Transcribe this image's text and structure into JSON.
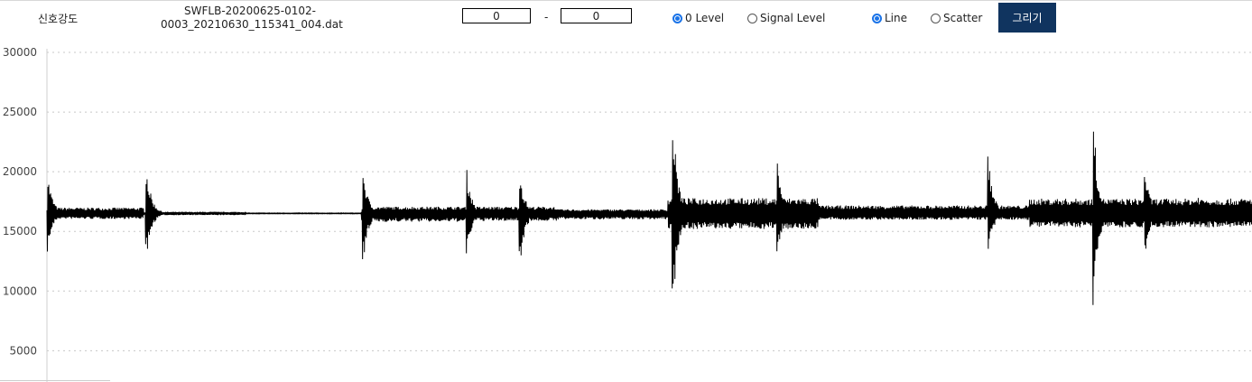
{
  "toolbar": {
    "signal_label": "신호강도",
    "file_name_line1": "SWFLB-20200625-0102-",
    "file_name_line2": "0003_20210630_115341_004.dat",
    "range_start": "0",
    "range_separator": "-",
    "range_end": "0",
    "level_options": [
      {
        "label": "0 Level",
        "checked": true
      },
      {
        "label": "Signal Level",
        "checked": false
      }
    ],
    "plot_options": [
      {
        "label": "Line",
        "checked": true
      },
      {
        "label": "Scatter",
        "checked": false
      }
    ],
    "draw_button": "그리기",
    "accent_color": "#1a73e8",
    "button_color": "#10345f"
  },
  "chart_data": {
    "type": "line",
    "title": "",
    "xlabel": "",
    "ylabel": "",
    "ylim": [
      3000,
      30000
    ],
    "yticks": [
      5000,
      10000,
      15000,
      20000,
      25000,
      30000
    ],
    "grid": "horizontal dotted",
    "line_color": "#000000",
    "baseline": 16500,
    "x_range": [
      0,
      1000
    ],
    "x_axis_visible": false,
    "series": [
      {
        "style": "dense waveform",
        "segments": [
          {
            "x": [
              0,
              80
            ],
            "min": 13200,
            "max": 20000
          },
          {
            "x": [
              80,
              165
            ],
            "min": 15500,
            "max": 17500
          },
          {
            "x": [
              165,
              261
            ],
            "min": 16300,
            "max": 16800
          },
          {
            "x": [
              261,
              350
            ],
            "min": 11500,
            "max": 20600
          },
          {
            "x": [
              350,
              423
            ],
            "min": 12000,
            "max": 20600
          },
          {
            "x": [
              423,
              515
            ],
            "min": 13000,
            "max": 19000
          },
          {
            "x": [
              515,
              640
            ],
            "min": 7200,
            "max": 25700
          },
          {
            "x": [
              640,
              815
            ],
            "min": 12700,
            "max": 21300
          },
          {
            "x": [
              815,
              1000
            ],
            "min": 8200,
            "max": 25400
          }
        ],
        "bursts": [
          {
            "x": 0.5,
            "min": 13200,
            "max": 20000
          },
          {
            "x": 82,
            "min": 12200,
            "max": 21000
          },
          {
            "x": 262,
            "min": 11500,
            "max": 20600
          },
          {
            "x": 348,
            "min": 12500,
            "max": 20600
          },
          {
            "x": 392,
            "min": 11500,
            "max": 20500
          },
          {
            "x": 519,
            "min": 7200,
            "max": 25700
          },
          {
            "x": 606,
            "min": 12700,
            "max": 21300
          },
          {
            "x": 781,
            "min": 12700,
            "max": 21800
          },
          {
            "x": 868,
            "min": 8200,
            "max": 25400
          },
          {
            "x": 911,
            "min": 12200,
            "max": 20600
          },
          {
            "x": 955,
            "min": 15000,
            "max": 18300
          }
        ]
      }
    ]
  }
}
